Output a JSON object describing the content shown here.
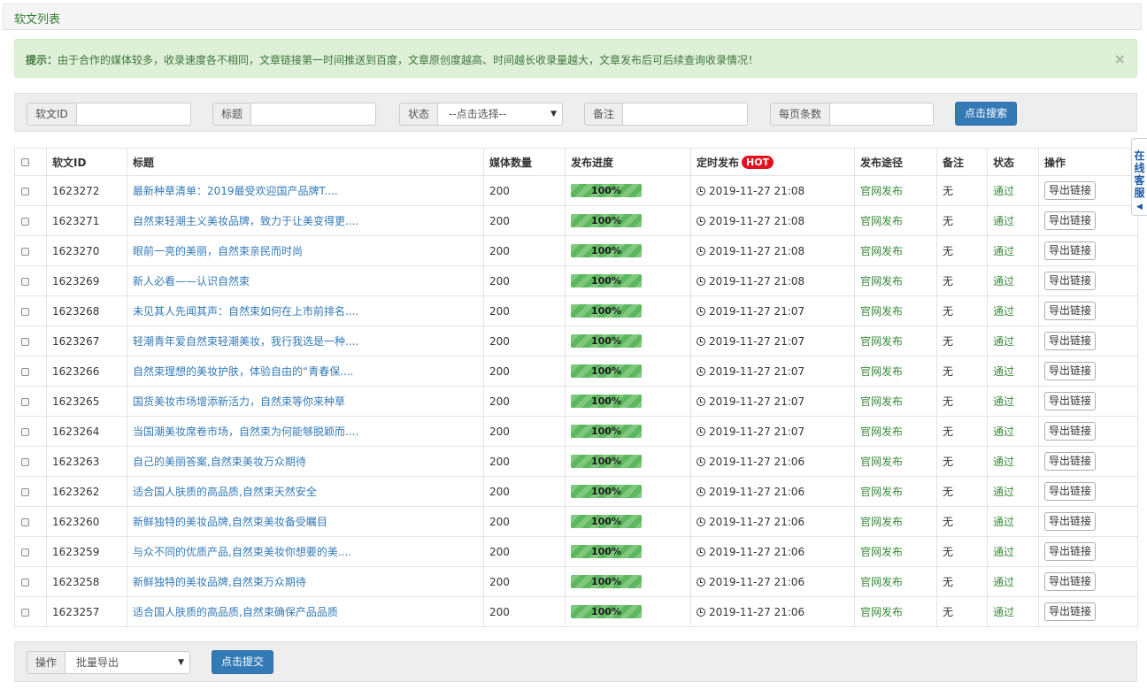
{
  "panel": {
    "title": "软文列表"
  },
  "alert": {
    "label": "提示：",
    "message": "由于合作的媒体较多，收录速度各不相同，文章链接第一时间推送到百度，文章原创度越高、时间越长收录量越大，文章发布后可后续查询收录情况！",
    "close": "×"
  },
  "search": {
    "id_label": "软文ID",
    "title_label": "标题",
    "status_label": "状态",
    "status_selected": "--点击选择--",
    "remark_label": "备注",
    "per_page_label": "每页条数",
    "submit_label": "点击搜索"
  },
  "table": {
    "headers": {
      "id": "软文ID",
      "title": "标题",
      "media_count": "媒体数量",
      "progress": "发布进度",
      "scheduled": "定时发布",
      "hot": "HOT",
      "route": "发布途径",
      "remark": "备注",
      "status": "状态",
      "action": "操作"
    },
    "rows": [
      {
        "id": "1623272",
        "title": "最新种草清单：2019最受欢迎国产品牌T....",
        "media": "200",
        "progress_label": "100%",
        "progress": 1.0,
        "time": "2019-11-27 21:08",
        "route": "官网发布",
        "remark": "无",
        "status": "通过",
        "action": "导出链接"
      },
      {
        "id": "1623271",
        "title": "自然束轻潮主义美妆品牌，致力于让美变得更....",
        "media": "200",
        "progress_label": "100%",
        "progress": 1.0,
        "time": "2019-11-27 21:08",
        "route": "官网发布",
        "remark": "无",
        "status": "通过",
        "action": "导出链接"
      },
      {
        "id": "1623270",
        "title": "眼前一亮的美丽，自然束亲民而时尚",
        "media": "200",
        "progress_label": "100%",
        "progress": 1.0,
        "time": "2019-11-27 21:08",
        "route": "官网发布",
        "remark": "无",
        "status": "通过",
        "action": "导出链接"
      },
      {
        "id": "1623269",
        "title": "新人必看——认识自然束",
        "media": "200",
        "progress_label": "100%",
        "progress": 1.0,
        "time": "2019-11-27 21:08",
        "route": "官网发布",
        "remark": "无",
        "status": "通过",
        "action": "导出链接"
      },
      {
        "id": "1623268",
        "title": "未见其人先闻其声：自然束如何在上市前排名....",
        "media": "200",
        "progress_label": "100%",
        "progress": 1.0,
        "time": "2019-11-27 21:07",
        "route": "官网发布",
        "remark": "无",
        "status": "通过",
        "action": "导出链接"
      },
      {
        "id": "1623267",
        "title": "轻潮青年爱自然束轻潮美妆，我行我选是一种....",
        "media": "200",
        "progress_label": "100%",
        "progress": 1.0,
        "time": "2019-11-27 21:07",
        "route": "官网发布",
        "remark": "无",
        "status": "通过",
        "action": "导出链接"
      },
      {
        "id": "1623266",
        "title": "自然束理想的美妆护肤，体验自由的“青春保....",
        "media": "200",
        "progress_label": "100%",
        "progress": 1.0,
        "time": "2019-11-27 21:07",
        "route": "官网发布",
        "remark": "无",
        "status": "通过",
        "action": "导出链接"
      },
      {
        "id": "1623265",
        "title": "国货美妆市场增添新活力，自然束等你来种草",
        "media": "200",
        "progress_label": "100%",
        "progress": 1.0,
        "time": "2019-11-27 21:07",
        "route": "官网发布",
        "remark": "无",
        "status": "通过",
        "action": "导出链接"
      },
      {
        "id": "1623264",
        "title": "当国潮美妆席卷市场，自然束为何能够脱颖而....",
        "media": "200",
        "progress_label": "100%",
        "progress": 1.0,
        "time": "2019-11-27 21:07",
        "route": "官网发布",
        "remark": "无",
        "status": "通过",
        "action": "导出链接"
      },
      {
        "id": "1623263",
        "title": "自己的美丽答案,自然束美妆万众期待",
        "media": "200",
        "progress_label": "100%",
        "progress": 1.0,
        "time": "2019-11-27 21:06",
        "route": "官网发布",
        "remark": "无",
        "status": "通过",
        "action": "导出链接"
      },
      {
        "id": "1623262",
        "title": "适合国人肤质的高品质,自然束天然安全",
        "media": "200",
        "progress_label": "100%",
        "progress": 1.0,
        "time": "2019-11-27 21:06",
        "route": "官网发布",
        "remark": "无",
        "status": "通过",
        "action": "导出链接"
      },
      {
        "id": "1623260",
        "title": "新鲜独特的美妆品牌,自然束美妆备受瞩目",
        "media": "200",
        "progress_label": "100%",
        "progress": 1.0,
        "time": "2019-11-27 21:06",
        "route": "官网发布",
        "remark": "无",
        "status": "通过",
        "action": "导出链接"
      },
      {
        "id": "1623259",
        "title": "与众不同的优质产品,自然束美妆你想要的美....",
        "media": "200",
        "progress_label": "100%",
        "progress": 1.0,
        "time": "2019-11-27 21:06",
        "route": "官网发布",
        "remark": "无",
        "status": "通过",
        "action": "导出链接"
      },
      {
        "id": "1623258",
        "title": "新鲜独特的美妆品牌,自然束万众期待",
        "media": "200",
        "progress_label": "100%",
        "progress": 1.0,
        "time": "2019-11-27 21:06",
        "route": "官网发布",
        "remark": "无",
        "status": "通过",
        "action": "导出链接"
      },
      {
        "id": "1623257",
        "title": "适合国人肤质的高品质,自然束确保产品品质",
        "media": "200",
        "progress_label": "100%",
        "progress": 1.0,
        "time": "2019-11-27 21:06",
        "route": "官网发布",
        "remark": "无",
        "status": "通过",
        "action": "导出链接"
      }
    ]
  },
  "side_tab": {
    "chars": [
      "在",
      "线",
      "客",
      "服"
    ],
    "arrow": "◀"
  },
  "bulk": {
    "label": "操作",
    "selected": "批量导出",
    "submit_label": "点击提交"
  }
}
